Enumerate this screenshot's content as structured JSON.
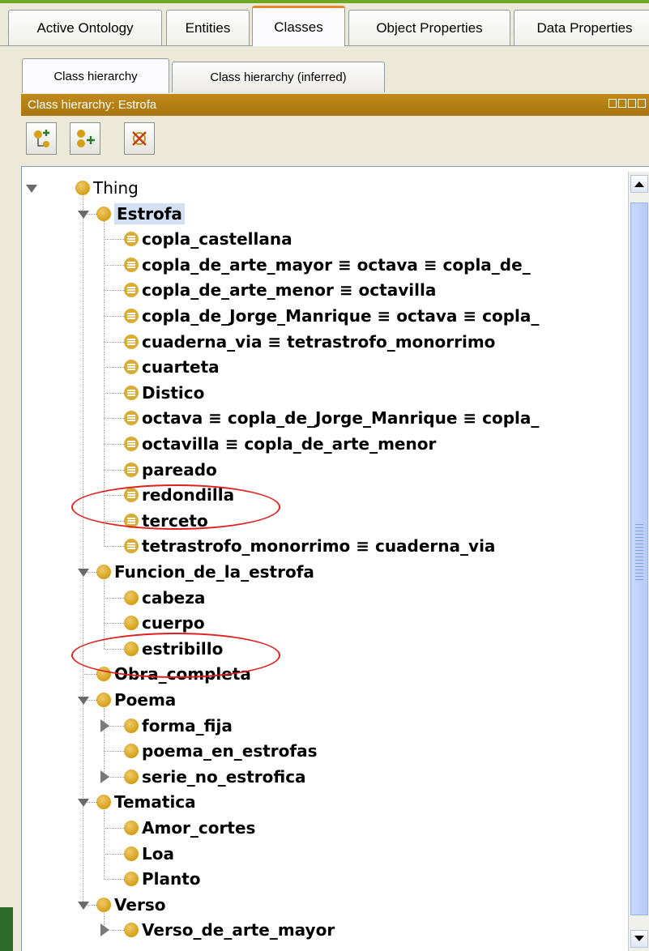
{
  "main_tabs": [
    "Active Ontology",
    "Entities",
    "Classes",
    "Object Properties",
    "Data Properties"
  ],
  "active_main_tab": "Classes",
  "sub_tabs": [
    "Class hierarchy",
    "Class hierarchy (inferred)"
  ],
  "panel_title": "Class hierarchy: Estrofa",
  "toolbar": {
    "add_subclass_icon": "add-subclass-icon",
    "add_sibling_icon": "add-sibling-icon",
    "delete_class_icon": "delete-class-icon"
  },
  "colors": {
    "accent_tab": "#e68b2c",
    "panel_title_bg": "#b07d14",
    "selection": "#d3e0f3",
    "annotation": "#e02020"
  },
  "tree": [
    {
      "label": "Thing",
      "depth": 0,
      "expander": "down",
      "icon": "class",
      "style": "plain"
    },
    {
      "label": "Estrofa",
      "depth": 1,
      "expander": "down",
      "icon": "class",
      "selected": true
    },
    {
      "label": "copla_castellana",
      "depth": 2,
      "icon": "defined"
    },
    {
      "label": "copla_de_arte_mayor ≡ octava ≡ copla_de_",
      "depth": 2,
      "icon": "defined"
    },
    {
      "label": "copla_de_arte_menor ≡ octavilla",
      "depth": 2,
      "icon": "defined"
    },
    {
      "label": "copla_de_Jorge_Manrique ≡ octava ≡ copla_",
      "depth": 2,
      "icon": "defined"
    },
    {
      "label": "cuaderna_via ≡ tetrastrofo_monorrimo",
      "depth": 2,
      "icon": "defined"
    },
    {
      "label": "cuarteta",
      "depth": 2,
      "icon": "defined"
    },
    {
      "label": "Distico",
      "depth": 2,
      "icon": "defined"
    },
    {
      "label": "octava ≡ copla_de_Jorge_Manrique ≡ copla_",
      "depth": 2,
      "icon": "defined"
    },
    {
      "label": "octavilla ≡ copla_de_arte_menor",
      "depth": 2,
      "icon": "defined"
    },
    {
      "label": "pareado",
      "depth": 2,
      "icon": "defined"
    },
    {
      "label": "redondilla",
      "depth": 2,
      "icon": "defined"
    },
    {
      "label": "terceto",
      "depth": 2,
      "icon": "defined"
    },
    {
      "label": "tetrastrofo_monorrimo ≡ cuaderna_via",
      "depth": 2,
      "icon": "defined"
    },
    {
      "label": "Funcion_de_la_estrofa",
      "depth": 1,
      "expander": "down",
      "icon": "class"
    },
    {
      "label": "cabeza",
      "depth": 2,
      "icon": "class"
    },
    {
      "label": "cuerpo",
      "depth": 2,
      "icon": "class"
    },
    {
      "label": "estribillo",
      "depth": 2,
      "icon": "class"
    },
    {
      "label": "Obra_completa",
      "depth": 1,
      "icon": "class"
    },
    {
      "label": "Poema",
      "depth": 1,
      "expander": "down",
      "icon": "class"
    },
    {
      "label": "forma_fija",
      "depth": 2,
      "expander": "right",
      "icon": "class"
    },
    {
      "label": "poema_en_estrofas",
      "depth": 2,
      "icon": "class"
    },
    {
      "label": "serie_no_estrofica",
      "depth": 2,
      "expander": "right",
      "icon": "class"
    },
    {
      "label": "Tematica",
      "depth": 1,
      "expander": "down",
      "icon": "class"
    },
    {
      "label": "Amor_cortes",
      "depth": 2,
      "icon": "class"
    },
    {
      "label": "Loa",
      "depth": 2,
      "icon": "class"
    },
    {
      "label": "Planto",
      "depth": 2,
      "icon": "class"
    },
    {
      "label": "Verso",
      "depth": 1,
      "expander": "down",
      "icon": "class"
    },
    {
      "label": "Verso_de_arte_mayor",
      "depth": 2,
      "expander": "right",
      "icon": "class"
    }
  ]
}
